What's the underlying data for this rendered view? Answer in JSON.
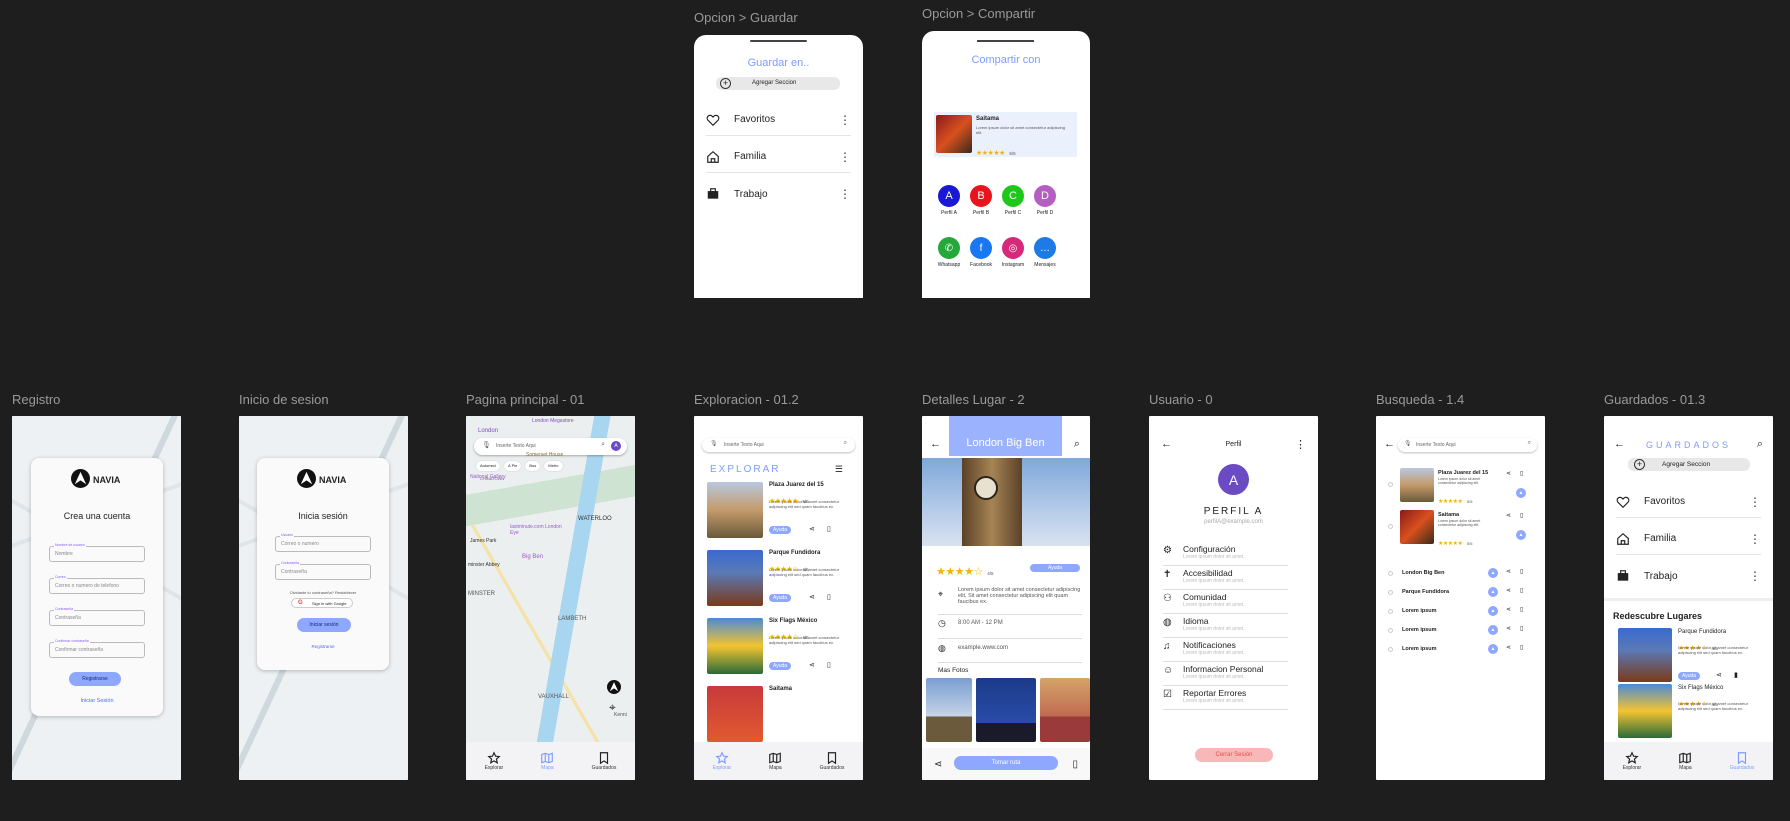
{
  "labels": {
    "guardar": "Opcion > Guardar",
    "compartir": "Opcion > Compartir",
    "registro": "Registro",
    "inicio": "Inicio de sesion",
    "principal": "Pagina principal - 01",
    "exploracion": "Exploracion - 01.2",
    "detalles": "Detalles Lugar - 2",
    "usuario": "Usuario - 0",
    "busqueda": "Busqueda - 1.4",
    "guardados": "Guardados - 01.3"
  },
  "guardar": {
    "title": "Guardar en..",
    "add": "Agregar Seccion",
    "items": [
      "Favoritos",
      "Familia",
      "Trabajo"
    ]
  },
  "compartir": {
    "title": "Compartir con",
    "place": "Saitama",
    "desc": "Lorem ipsum dolor sit amet consectetur adipiscing elit.",
    "stars": "★★★★★",
    "rating": "5/5",
    "profiles": [
      {
        "letter": "A",
        "name": "Perfil A",
        "color": "#1a17d6"
      },
      {
        "letter": "B",
        "name": "Perfil B",
        "color": "#e8131b"
      },
      {
        "letter": "C",
        "name": "Perfil C",
        "color": "#1ec81a"
      },
      {
        "letter": "D",
        "name": "Perfil D",
        "color": "#b45ec2"
      }
    ],
    "apps": [
      {
        "name": "Whatsapp",
        "color": "#25a83a"
      },
      {
        "name": "Facebook",
        "color": "#1877f2"
      },
      {
        "name": "Instagram",
        "color": "#d6297a"
      },
      {
        "name": "Mensajes",
        "color": "#1e7be6"
      }
    ]
  },
  "registro": {
    "brand": "NAVIA",
    "heading": "Crea una cuenta",
    "fields": [
      {
        "label": "Nombre de usuario",
        "placeholder": "Nombre"
      },
      {
        "label": "Correo",
        "placeholder": "Correo o numero de telefono"
      },
      {
        "label": "Contraseña",
        "placeholder": "Contraseña"
      },
      {
        "label": "Confirmar contraseña",
        "placeholder": "Confirmar contraseña"
      }
    ],
    "button": "Registrarse",
    "link": "Iniciar Sesión"
  },
  "inicio": {
    "brand": "NAVIA",
    "heading": "Inicia sesión",
    "fields": [
      {
        "label": "Usuario",
        "placeholder": "Correo o numero"
      },
      {
        "label": "Contraseña",
        "placeholder": "Contraseña"
      }
    ],
    "forgot": "Olvidaste tu contraseña? Restablecer",
    "google": "Sign in with Google",
    "button": "Iniciar sesión",
    "link": "Registrarse"
  },
  "principal": {
    "search": "Inserte Texto Aqui",
    "chips": [
      "Autorreci",
      "A Pie",
      "Bus",
      "Metro"
    ],
    "places": [
      "London",
      "London Megastore",
      "CHINATOWN",
      "Somerset House",
      "National Gallery",
      "WATERLOO",
      "lastminute.com London Eye",
      "James Park",
      "Big Ben",
      "minster Abbey",
      "MINSTER",
      "LAMBETH",
      "VAUXHALL",
      "Kenni"
    ],
    "nav": [
      "Explorar",
      "Mapa",
      "Guardados"
    ]
  },
  "exploracion": {
    "search": "Inserte Texto Aqui",
    "heading": "EXPLORAR",
    "items": [
      {
        "name": "Plaza Juarez del 15",
        "rating": "5/5",
        "stars": "★★★★★"
      },
      {
        "name": "Parque Fundidora",
        "rating": "4/5",
        "stars": "★★★★☆"
      },
      {
        "name": "Six Flags México",
        "rating": "4/5",
        "stars": "★★★★☆"
      },
      {
        "name": "Saitama",
        "rating": "",
        "stars": ""
      }
    ],
    "desc": "Lorem ipsum dolor sit amet consectetur adipiscing elit sed quam faucibus ex.",
    "ayuda": "Ayuda",
    "nav": [
      "Explorar",
      "Mapa",
      "Guardados"
    ]
  },
  "detalles": {
    "title": "London Big Ben",
    "stars": "★★★★☆",
    "rating": "4/5",
    "ayuda": "Ayuda",
    "address": "Lorem ipsum dolor sit amet consectetur adipiscing elit. Sit amet consectetur adipiscing elit quam faucibus ex.",
    "hours": "8:00 AM - 12 PM",
    "web": "example.www.com",
    "photos": "Mas Fotos",
    "route": "Tomar ruta"
  },
  "usuario": {
    "title": "Perfil",
    "avatar": "A",
    "name": "PERFIL A",
    "email": "perfilA@example.com",
    "menu": [
      {
        "label": "Configuración",
        "sub": "Lorem ipsum dolor sit amet."
      },
      {
        "label": "Accesibilidad",
        "sub": "Lorem ipsum dolor sit amet."
      },
      {
        "label": "Comunidad",
        "sub": "Lorem ipsum dolor sit amet."
      },
      {
        "label": "Idioma",
        "sub": "Lorem ipsum dolor sit amet."
      },
      {
        "label": "Notificaciones",
        "sub": "Lorem ipsum dolor sit amet."
      },
      {
        "label": "Informacion Personal",
        "sub": "Lorem ipsum dolor sit amet."
      },
      {
        "label": "Reportar Errores",
        "sub": "Lorem ipsum dolor sit amet."
      }
    ],
    "logout": "Cerrar Sesión"
  },
  "busqueda": {
    "search": "Inserte Texto Aqui",
    "results": [
      {
        "name": "Plaza Juarez del 15",
        "desc": "Lorem ipsum dolor sit amet consectetur adipiscing elit.",
        "rating": "5/5"
      },
      {
        "name": "Saitama",
        "desc": "Lorem ipsum dolor sit amet consectetur adipiscing elit.",
        "rating": "5/5"
      }
    ],
    "recent": [
      "London Big Ben",
      "Parque Fundidora",
      "Lorem ipsum",
      "Lorem ipsum",
      "Lorem ipsum"
    ]
  },
  "guardados": {
    "title": "GUARDADOS",
    "add": "Agregar Seccion",
    "items": [
      "Favoritos",
      "Familia",
      "Trabajo"
    ],
    "heading": "Redescubre Lugares",
    "places": [
      {
        "name": "Parque Fundidora",
        "rating": "4/5"
      },
      {
        "name": "Six Flags México",
        "rating": "4/5"
      }
    ],
    "desc": "Lorem ipsum dolor sit amet consectetur adipiscing elit sed quam faucibus ex.",
    "ayuda": "Ayuda",
    "nav": [
      "Explorar",
      "Mapa",
      "Guardados"
    ]
  },
  "colors": {
    "accent": "#8ea8ff",
    "avatar": "#6a4bc4",
    "logout": "#f7b6b6"
  }
}
